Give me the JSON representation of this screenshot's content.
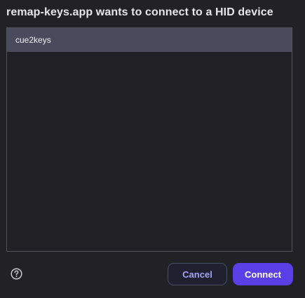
{
  "dialog": {
    "title": "remap-keys.app wants to connect to a HID device"
  },
  "device_list": {
    "items": [
      {
        "label": "cue2keys",
        "selected": true
      }
    ]
  },
  "footer": {
    "help_icon": "question-circle-icon",
    "cancel_label": "Cancel",
    "connect_label": "Connect"
  },
  "colors": {
    "background": "#222125",
    "selected_row": "#4b4a5c",
    "accent": "#5a3ee6",
    "cancel_text": "#a6a2f7"
  }
}
